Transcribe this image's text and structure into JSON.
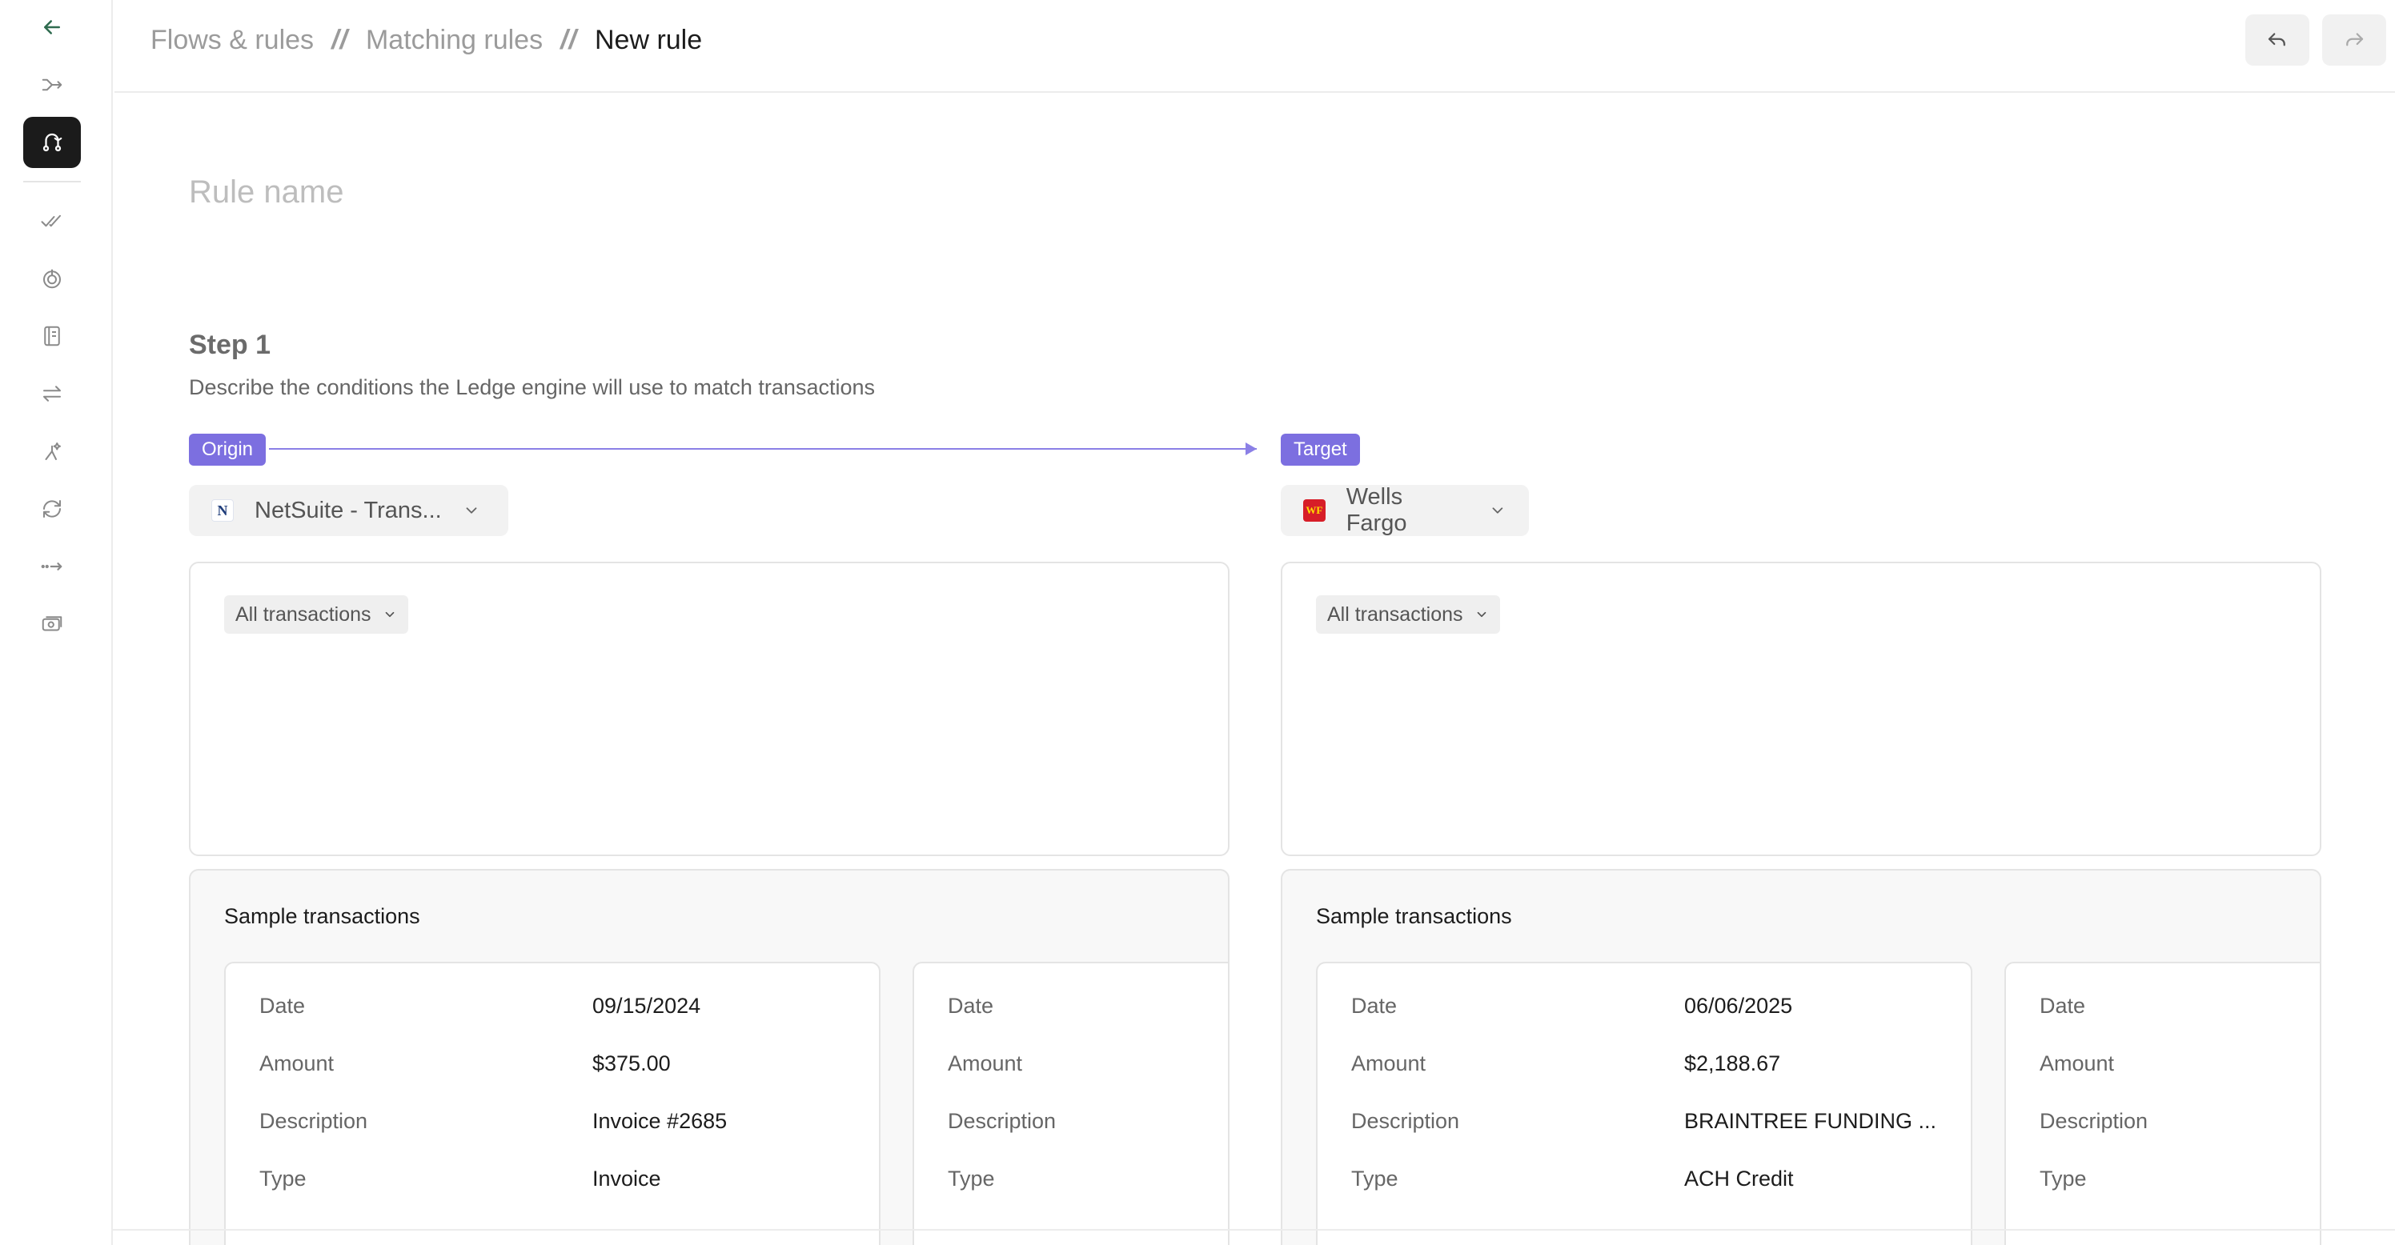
{
  "sidebar": {
    "back_icon": "arrow-left-icon",
    "items": [
      {
        "icon": "flow-merge-icon"
      },
      {
        "icon": "matching-rules-icon",
        "active": true
      },
      {
        "icon": "double-check-icon"
      },
      {
        "icon": "target-icon"
      },
      {
        "icon": "book-icon"
      },
      {
        "icon": "transfer-arrows-icon"
      },
      {
        "icon": "sparkle-flow-icon"
      },
      {
        "icon": "sync-icon"
      },
      {
        "icon": "dots-arrow-icon"
      },
      {
        "icon": "cash-icon"
      }
    ]
  },
  "header": {
    "breadcrumb": [
      "Flows & rules",
      "Matching rules",
      "New rule"
    ],
    "separator": "//",
    "undo_icon": "undo-icon",
    "redo_icon": "redo-icon"
  },
  "rule": {
    "name_placeholder": "Rule name",
    "name_value": ""
  },
  "step": {
    "title": "Step 1",
    "description": "Describe the conditions the Ledge engine will use to match transactions"
  },
  "origin": {
    "pill": "Origin",
    "source_label": "NetSuite - Trans...",
    "source_icon": "netsuite-logo",
    "filter": "All transactions",
    "sample_title": "Sample transactions",
    "cards": [
      {
        "date_label": "Date",
        "date": "09/15/2024",
        "amount_label": "Amount",
        "amount": "$375.00",
        "description_label": "Description",
        "description": "Invoice #2685",
        "type_label": "Type",
        "type": "Invoice"
      },
      {
        "date_label": "Date",
        "date": "",
        "amount_label": "Amount",
        "amount": "",
        "description_label": "Description",
        "description": "",
        "type_label": "Type",
        "type": ""
      }
    ]
  },
  "target": {
    "pill": "Target",
    "source_label": "Wells Fargo",
    "source_icon": "wells-fargo-logo",
    "filter": "All transactions",
    "sample_title": "Sample transactions",
    "cards": [
      {
        "date_label": "Date",
        "date": "06/06/2025",
        "amount_label": "Amount",
        "amount": "$2,188.67",
        "description_label": "Description",
        "description": "BRAINTREE FUNDING ...",
        "type_label": "Type",
        "type": "ACH Credit"
      },
      {
        "date_label": "Date",
        "date": "",
        "amount_label": "Amount",
        "amount": "",
        "description_label": "Description",
        "description": "",
        "type_label": "Type",
        "type": ""
      }
    ]
  },
  "colors": {
    "accent": "#7c6fe0",
    "sidebar_active": "#1b1b1b",
    "wells_fargo_red": "#d71e28"
  }
}
